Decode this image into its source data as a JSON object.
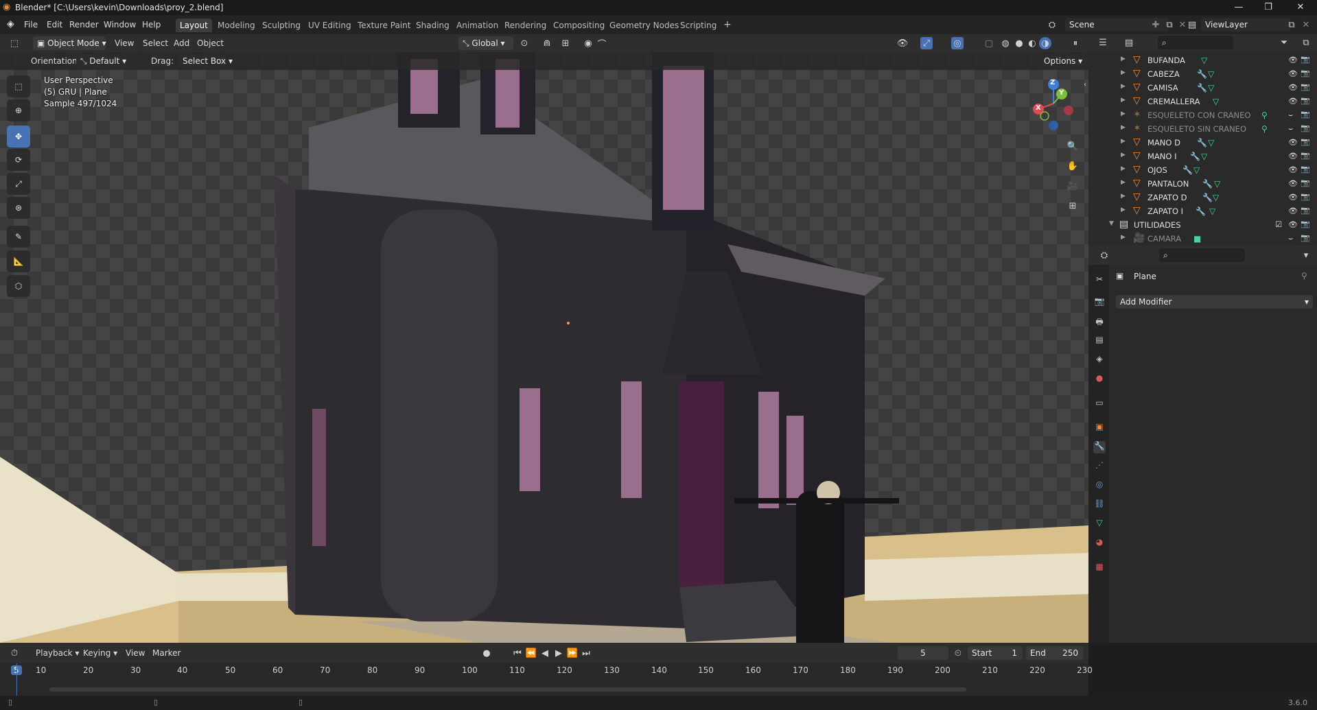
{
  "window": {
    "title": "Blender* [C:\\Users\\kevin\\Downloads\\proy_2.blend]",
    "minimize": "—",
    "maximize": "❐",
    "close": "✕"
  },
  "menu": {
    "items": [
      "File",
      "Edit",
      "Render",
      "Window",
      "Help"
    ]
  },
  "workspaces": {
    "tabs": [
      "Layout",
      "Modeling",
      "Sculpting",
      "UV Editing",
      "Texture Paint",
      "Shading",
      "Animation",
      "Rendering",
      "Compositing",
      "Geometry Nodes",
      "Scripting"
    ],
    "active": "Layout",
    "add": "+"
  },
  "scene": {
    "label": "Scene",
    "view_layer": "ViewLayer"
  },
  "viewport_header": {
    "mode": "Object Mode",
    "menus": [
      "View",
      "Select",
      "Add",
      "Object"
    ],
    "transform": "Global"
  },
  "viewport_options": {
    "orientation_label": "Orientation:",
    "orientation_value": "Default",
    "drag_label": "Drag:",
    "drag_value": "Select Box",
    "options": "Options"
  },
  "viewport_info": {
    "line1": "User Perspective",
    "line2": "(5) GRU | Plane",
    "line3": "Sample 497/1024"
  },
  "gizmo": {
    "x": "X",
    "y": "Y",
    "z": "Z"
  },
  "outliner": {
    "items": [
      {
        "name": "BUFANDA",
        "dim": false,
        "modifier": false
      },
      {
        "name": "CABEZA",
        "dim": false,
        "modifier": true
      },
      {
        "name": "CAMISA",
        "dim": false,
        "modifier": true
      },
      {
        "name": "CREMALLERA",
        "dim": false,
        "modifier": false
      },
      {
        "name": "ESQUELETO CON CRANEO",
        "dim": true,
        "modifier": false
      },
      {
        "name": "ESQUELETO SIN CRANEO",
        "dim": true,
        "modifier": false
      },
      {
        "name": "MANO D",
        "dim": false,
        "modifier": true
      },
      {
        "name": "MANO I",
        "dim": false,
        "modifier": true
      },
      {
        "name": "OJOS",
        "dim": false,
        "modifier": true
      },
      {
        "name": "PANTALON",
        "dim": false,
        "modifier": true
      },
      {
        "name": "ZAPATO D",
        "dim": false,
        "modifier": true
      },
      {
        "name": "ZAPATO I",
        "dim": false,
        "modifier": true
      }
    ],
    "collection": "UTILIDADES",
    "camera": "CAMARA"
  },
  "properties": {
    "object": "Plane",
    "add_modifier": "Add Modifier"
  },
  "timeline": {
    "menus": [
      "Playback",
      "Keying",
      "View",
      "Marker"
    ],
    "current_frame": "5",
    "start_label": "Start",
    "start": "1",
    "end_label": "End",
    "end": "250",
    "ticks": [
      "5",
      "10",
      "20",
      "30",
      "40",
      "50",
      "60",
      "70",
      "80",
      "90",
      "100",
      "110",
      "120",
      "130",
      "140",
      "150",
      "160",
      "170",
      "180",
      "190",
      "200",
      "210",
      "220",
      "230"
    ]
  },
  "status": {
    "version": "3.6.0"
  },
  "colors": {
    "accent": "#4772b3",
    "object": "#e88b3f",
    "modifier": "#6fa3e2",
    "mesh": "#4cd29a",
    "axis_x": "#e04a55",
    "axis_y": "#7bbf3a",
    "axis_z": "#3f7fdc"
  }
}
